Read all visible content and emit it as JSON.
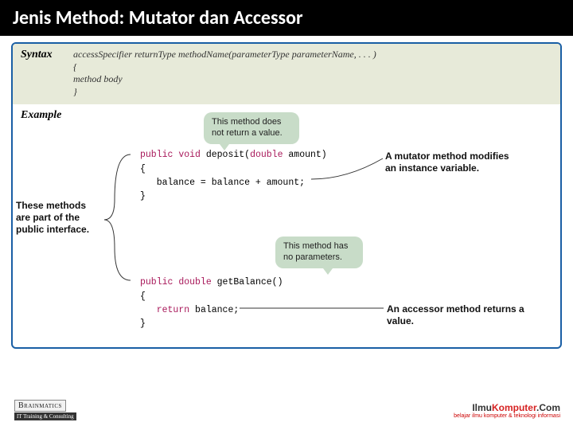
{
  "title": "Jenis Method: Mutator dan Accessor",
  "syntax": {
    "label": "Syntax",
    "line1": "accessSpecifier  returnType  methodName(parameterType  parameterName, . . . )",
    "line2": "{",
    "line3": "    method body",
    "line4": "}"
  },
  "example": {
    "label": "Example",
    "callout1_l1": "This method does",
    "callout1_l2": "not return a value.",
    "callout2_l1": "This method has",
    "callout2_l2": "no parameters.",
    "sidenote_l1": "These methods",
    "sidenote_l2": "are part of the",
    "sidenote_l3": "public interface.",
    "right1_l1": "A mutator method modifies",
    "right1_l2": "an instance variable.",
    "right2": "An accessor method returns a value.",
    "code1": {
      "k_public": "public",
      "k_void": "void",
      "name": " deposit(",
      "k_double": "double",
      "arg": " amount)",
      "brace_o": "{",
      "body": "   balance = balance + amount;",
      "brace_c": "}"
    },
    "code2": {
      "k_public": "public",
      "k_double": "double",
      "name": " getBalance()",
      "brace_o": "{",
      "k_return": "return",
      "body": " balance;",
      "brace_c": "}"
    }
  },
  "footer": {
    "brainmatics": "Brainmatics",
    "brainmatics_sub": "IT Training & Consulting",
    "ilmu": "Ilmu",
    "komputer": "Komputer",
    "com": ".Com",
    "tagline": "belajar ilmu komputer & teknologi informasi"
  }
}
